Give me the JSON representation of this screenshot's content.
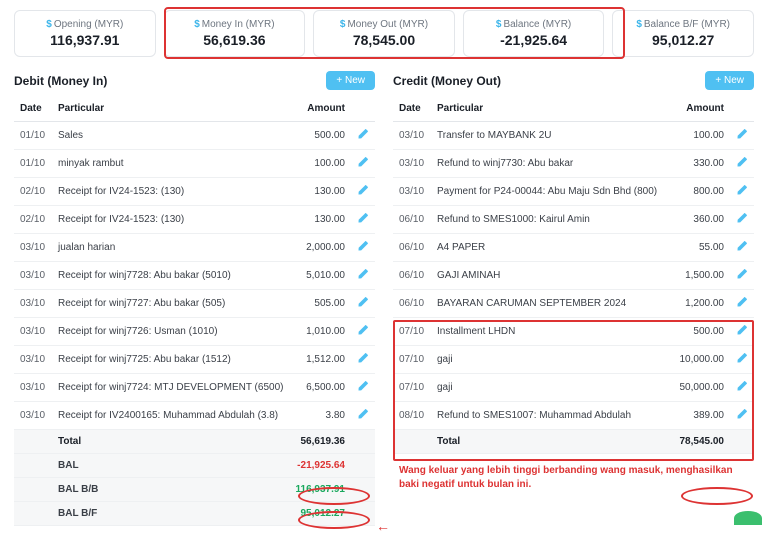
{
  "cards": [
    {
      "label_prefix": "$",
      "label": "Opening (MYR)",
      "value": "116,937.91"
    },
    {
      "label_prefix": "$",
      "label": "Money In (MYR)",
      "value": "56,619.36"
    },
    {
      "label_prefix": "$",
      "label": "Money Out (MYR)",
      "value": "78,545.00"
    },
    {
      "label_prefix": "$",
      "label": "Balance (MYR)",
      "value": "-21,925.64"
    },
    {
      "label_prefix": "$",
      "label": "Balance B/F (MYR)",
      "value": "95,012.27"
    }
  ],
  "debit": {
    "title": "Debit (Money In)",
    "new_label": "+ New",
    "headers": {
      "date": "Date",
      "particular": "Particular",
      "amount": "Amount"
    },
    "rows": [
      {
        "date": "01/10",
        "particular": "Sales",
        "amount": "500.00"
      },
      {
        "date": "01/10",
        "particular": "minyak rambut",
        "amount": "100.00"
      },
      {
        "date": "02/10",
        "particular": "Receipt for IV24-1523: (130)",
        "amount": "130.00"
      },
      {
        "date": "02/10",
        "particular": "Receipt for IV24-1523: (130)",
        "amount": "130.00"
      },
      {
        "date": "03/10",
        "particular": "jualan harian",
        "amount": "2,000.00"
      },
      {
        "date": "03/10",
        "particular": "Receipt for winj7728: Abu bakar (5010)",
        "amount": "5,010.00"
      },
      {
        "date": "03/10",
        "particular": "Receipt for winj7727: Abu bakar (505)",
        "amount": "505.00"
      },
      {
        "date": "03/10",
        "particular": "Receipt for winj7726: Usman (1010)",
        "amount": "1,010.00"
      },
      {
        "date": "03/10",
        "particular": "Receipt for winj7725: Abu bakar (1512)",
        "amount": "1,512.00"
      },
      {
        "date": "03/10",
        "particular": "Receipt for winj7724: MTJ DEVELOPMENT (6500)",
        "amount": "6,500.00"
      },
      {
        "date": "03/10",
        "particular": "Receipt for IV2400165: Muhammad Abdulah (3.8)",
        "amount": "3.80"
      }
    ],
    "footer": [
      {
        "label": "Total",
        "value": "56,619.36",
        "cls": ""
      },
      {
        "label": "BAL",
        "value": "-21,925.64",
        "cls": "neg"
      },
      {
        "label": "BAL B/B",
        "value": "116,937.91",
        "cls": "pos"
      },
      {
        "label": "BAL B/F",
        "value": "95,012.27",
        "cls": "pos"
      }
    ]
  },
  "credit": {
    "title": "Credit (Money Out)",
    "new_label": "+ New",
    "headers": {
      "date": "Date",
      "particular": "Particular",
      "amount": "Amount"
    },
    "rows": [
      {
        "date": "03/10",
        "particular": "Transfer to MAYBANK 2U",
        "amount": "100.00"
      },
      {
        "date": "03/10",
        "particular": "Refund to winj7730: Abu bakar",
        "amount": "330.00"
      },
      {
        "date": "03/10",
        "particular": "Payment for P24-00044: Abu Maju Sdn Bhd (800)",
        "amount": "800.00"
      },
      {
        "date": "06/10",
        "particular": "Refund to SMES1000: Kairul Amin",
        "amount": "360.00"
      },
      {
        "date": "06/10",
        "particular": "A4 PAPER",
        "amount": "55.00"
      },
      {
        "date": "06/10",
        "particular": "GAJI AMINAH",
        "amount": "1,500.00"
      },
      {
        "date": "06/10",
        "particular": "BAYARAN CARUMAN SEPTEMBER 2024",
        "amount": "1,200.00"
      },
      {
        "date": "07/10",
        "particular": "Installment LHDN",
        "amount": "500.00"
      },
      {
        "date": "07/10",
        "particular": "gaji",
        "amount": "10,000.00"
      },
      {
        "date": "07/10",
        "particular": "gaji",
        "amount": "50,000.00"
      },
      {
        "date": "08/10",
        "particular": "Refund to SMES1007: Muhammad Abdulah",
        "amount": "389.00"
      }
    ],
    "footer": [
      {
        "label": "Total",
        "value": "78,545.00",
        "cls": ""
      }
    ],
    "note": "Wang keluar yang lebih tinggi berbanding wang masuk, menghasilkan baki negatif untuk bulan ini."
  }
}
